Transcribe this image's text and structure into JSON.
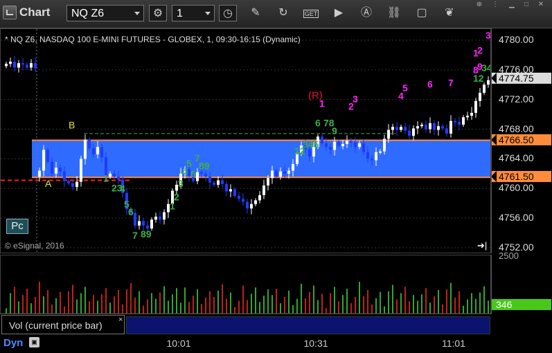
{
  "toolbar": {
    "app_title": "Chart",
    "symbol": "NQ Z6",
    "interval": "1"
  },
  "chart": {
    "header": "* NQ Z6, NASDAQ 100 E-MINI FUTURES - GLOBEX, 1, 09:30-16:15 (Dynamic)",
    "copyright": "© eSignal, 2016",
    "badge": "Pc",
    "price_axis": [
      "4780.00",
      "4776.00",
      "4772.00",
      "4768.00",
      "4764.00",
      "4760.00",
      "4756.00",
      "4752.00"
    ],
    "current_price": "4774.75",
    "zone_high": "4766.50",
    "zone_low": "4761.50",
    "label_b": "B",
    "label_a": "A",
    "label_r": "(R)",
    "colors": {
      "zone": "#2f6bff",
      "zone_line": "#ff8c3a",
      "up_bar": "#ffffff",
      "down_bar": "#1f3bff",
      "setup_green": "#3cb043",
      "setup_magenta": "#ff22ff",
      "r_label": "#a0102a"
    },
    "setup_counts": [
      {
        "text": "1",
        "color": "green",
        "price": 4760.9,
        "slot": 24
      },
      {
        "text": "23",
        "color": "green",
        "price": 4759.6,
        "slot": 26
      },
      {
        "text": "4",
        "color": "green",
        "price": 4759.5,
        "slot": 28
      },
      {
        "text": "5",
        "color": "green",
        "price": 4757.4,
        "slot": 29
      },
      {
        "text": "6",
        "color": "green",
        "price": 4756.4,
        "slot": 30
      },
      {
        "text": "7",
        "color": "green",
        "price": 4753.2,
        "slot": 31
      },
      {
        "text": "89",
        "color": "green",
        "price": 4753.4,
        "slot": 33
      },
      {
        "text": "1",
        "color": "green",
        "price": 4757.2,
        "slot": 40
      },
      {
        "text": "2",
        "color": "green",
        "price": 4758.4,
        "slot": 41
      },
      {
        "text": "3",
        "color": "green",
        "price": 4760.2,
        "slot": 42
      },
      {
        "text": "4",
        "color": "green",
        "price": 4761.8,
        "slot": 43
      },
      {
        "text": "5",
        "color": "green",
        "price": 4762.9,
        "slot": 44
      },
      {
        "text": "6",
        "color": "green",
        "price": 4761.5,
        "slot": 45
      },
      {
        "text": "7",
        "color": "green",
        "price": 4763.6,
        "slot": 46
      },
      {
        "text": "89",
        "color": "green",
        "price": 4762.6,
        "slot": 47
      },
      {
        "text": "12",
        "color": "green",
        "price": 4764.6,
        "slot": 70
      },
      {
        "text": "345",
        "color": "green",
        "price": 4765.5,
        "slot": 72
      },
      {
        "text": "6",
        "color": "green",
        "price": 4768.4,
        "slot": 75
      },
      {
        "text": "78",
        "color": "green",
        "price": 4768.4,
        "slot": 77
      },
      {
        "text": "9",
        "color": "green",
        "price": 4767.3,
        "slot": 79
      },
      {
        "text": "1",
        "color": "magenta",
        "price": 4771.0,
        "slot": 76
      },
      {
        "text": "2",
        "color": "magenta",
        "price": 4770.6,
        "slot": 83
      },
      {
        "text": "3",
        "color": "magenta",
        "price": 4771.6,
        "slot": 84
      },
      {
        "text": "4",
        "color": "magenta",
        "price": 4772.0,
        "slot": 95
      },
      {
        "text": "5",
        "color": "magenta",
        "price": 4773.1,
        "slot": 96
      },
      {
        "text": "6",
        "color": "magenta",
        "price": 4773.6,
        "slot": 102
      },
      {
        "text": "7",
        "color": "magenta",
        "price": 4773.8,
        "slot": 107
      },
      {
        "text": "12",
        "color": "green",
        "price": 4774.4,
        "slot": 113
      },
      {
        "text": "34",
        "color": "green",
        "price": 4775.8,
        "slot": 115
      },
      {
        "text": "1",
        "color": "magenta",
        "price": 4777.8,
        "slot": 113
      },
      {
        "text": "2",
        "color": "magenta",
        "price": 4778.2,
        "slot": 114
      },
      {
        "text": "8",
        "color": "magenta",
        "price": 4775.5,
        "slot": 113
      },
      {
        "text": "9",
        "color": "magenta",
        "price": 4776.0,
        "slot": 114
      },
      {
        "text": "34",
        "color": "magenta",
        "price": 4780.2,
        "slot": 116
      }
    ]
  },
  "volume": {
    "axis_label": "2500",
    "current_value": "346",
    "study_label": "Vol (current price bar)",
    "close_glyph": "×"
  },
  "time_axis": {
    "labels": [
      "10:01",
      "10:31",
      "11:01"
    ],
    "mode": "Dyn"
  },
  "chart_data": [
    {
      "type": "candlestick",
      "title": "* NQ Z6, NASDAQ 100 E-MINI FUTURES - GLOBEX, 1, 09:30-16:15 (Dynamic)",
      "ylim": [
        4751,
        4781.5
      ],
      "x_ticks": [
        "10:01",
        "10:31",
        "11:01"
      ],
      "y_ticks": [
        4752,
        4756,
        4760,
        4764,
        4768,
        4772,
        4776,
        4780
      ],
      "levels": [
        {
          "name": "4766.50",
          "value": 4766.5
        },
        {
          "name": "4761.50",
          "value": 4761.5
        }
      ],
      "last_price": 4774.75,
      "closes": [
        4776.8,
        4777.1,
        4776.3,
        4776.9,
        4776.7,
        4776.3,
        4776.9,
        4776.2,
        4762.4,
        4765.2,
        4763.6,
        4762.0,
        4762.8,
        4762.3,
        4761.0,
        4760.7,
        4760.2,
        4760.9,
        4764.0,
        4766.6,
        4765.4,
        4764.6,
        4765.6,
        4764.2,
        4761.6,
        4762.0,
        4761.6,
        4761.2,
        4759.4,
        4757.2,
        4756.7,
        4755.0,
        4755.6,
        4755.0,
        4754.6,
        4755.8,
        4756.2,
        4755.8,
        4756.8,
        4757.9,
        4759.7,
        4760.5,
        4762.0,
        4762.6,
        4761.7,
        4761.0,
        4762.2,
        4762.0,
        4761.6,
        4760.8,
        4760.5,
        4761.1,
        4760.6,
        4759.6,
        4759.9,
        4759.0,
        4758.6,
        4758.2,
        4757.3,
        4757.9,
        4758.4,
        4759.1,
        4760.4,
        4761.4,
        4762.4,
        4761.6,
        4762.3,
        4762.0,
        4762.4,
        4763.3,
        4764.8,
        4765.8,
        4765.3,
        4764.3,
        4765.6,
        4767.0,
        4766.1,
        4765.6,
        4765.2,
        4766.3,
        4765.7,
        4766.0,
        4766.4,
        4766.2,
        4765.6,
        4766.1,
        4764.9,
        4764.0,
        4763.8,
        4764.9,
        4765.0,
        4766.7,
        4767.9,
        4768.3,
        4767.9,
        4768.3,
        4767.8,
        4767.1,
        4768.1,
        4768.4,
        4768.6,
        4768.0,
        4768.8,
        4767.9,
        4768.4,
        4768.1,
        4767.4,
        4769.1,
        4769.0,
        4768.6,
        4769.6,
        4769.8,
        4770.2,
        4771.8,
        4772.9,
        4774.0,
        4774.6,
        4774.75
      ],
      "volume": {
        "axis_max_label": 2500,
        "last": 346
      }
    }
  ]
}
